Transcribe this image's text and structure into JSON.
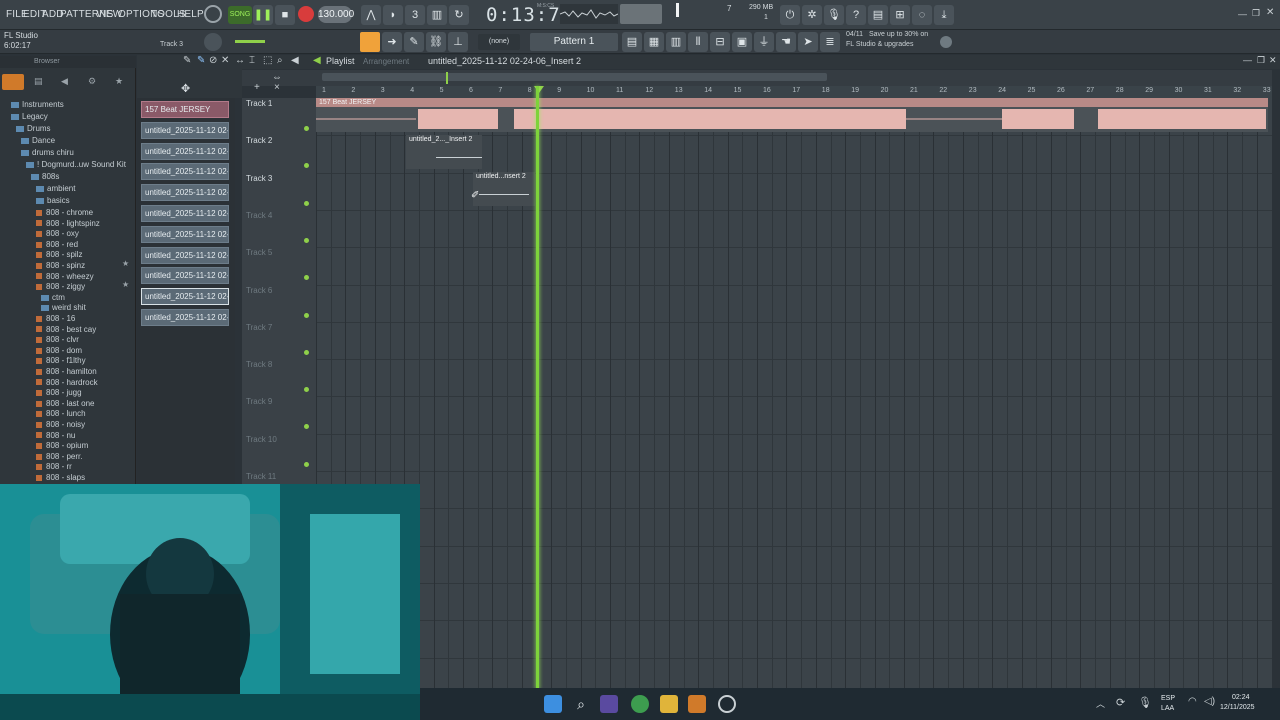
{
  "menu": [
    "FILE",
    "EDIT",
    "ADD",
    "PATTERNS",
    "VIEW",
    "OPTIONS",
    "TOOLS",
    "HELP"
  ],
  "transport": {
    "mode": "SONG",
    "tempo": "130.000",
    "time": "0:13:70",
    "time_label": "M:S:CS",
    "cpu_value": "7",
    "ram": "290 MB",
    "voices": "1"
  },
  "app": {
    "name": "FL Studio",
    "elapsed": "6:02:17",
    "hint_track": "Track 3"
  },
  "pattern": {
    "snap": "(none)",
    "name": "Pattern 1",
    "promo_date": "04/11",
    "promo_line1": "Save up to 30% on",
    "promo_line2": "FL Studio & upgrades"
  },
  "browser": {
    "title": "Browser",
    "items": [
      {
        "label": "Instruments",
        "type": "folder",
        "level": 1
      },
      {
        "label": "Legacy",
        "type": "folder",
        "level": 1
      },
      {
        "label": "Drums",
        "type": "folder",
        "level": 2
      },
      {
        "label": "Dance",
        "type": "folder",
        "level": 3
      },
      {
        "label": "drums chiru",
        "type": "folder",
        "level": 3
      },
      {
        "label": "! Dogmurd..uw Sound Kit",
        "type": "folder",
        "level": 4
      },
      {
        "label": "808s",
        "type": "folder",
        "level": 5
      },
      {
        "label": "ambient",
        "type": "folder",
        "level": 6
      },
      {
        "label": "basics",
        "type": "folder",
        "level": 6
      },
      {
        "label": "808 - chrome",
        "type": "file",
        "level": 6
      },
      {
        "label": "808 - lightspinz",
        "type": "file",
        "level": 6
      },
      {
        "label": "808 - oxy",
        "type": "file",
        "level": 6
      },
      {
        "label": "808 - red",
        "type": "file",
        "level": 6
      },
      {
        "label": "808 - spilz",
        "type": "file",
        "level": 6
      },
      {
        "label": "808 - spinz",
        "type": "file",
        "level": 6
      },
      {
        "label": "808 - wheezy",
        "type": "file",
        "level": 6
      },
      {
        "label": "808 - ziggy",
        "type": "file",
        "level": 6
      },
      {
        "label": "ctm",
        "type": "folder",
        "level": 7
      },
      {
        "label": "weird shit",
        "type": "folder",
        "level": 7
      },
      {
        "label": "808 - 16",
        "type": "file",
        "level": 6
      },
      {
        "label": "808 - best cay",
        "type": "file",
        "level": 6
      },
      {
        "label": "808 - clvr",
        "type": "file",
        "level": 6
      },
      {
        "label": "808 - dom",
        "type": "file",
        "level": 6
      },
      {
        "label": "808 - f1lthy",
        "type": "file",
        "level": 6
      },
      {
        "label": "808 - hamilton",
        "type": "file",
        "level": 6
      },
      {
        "label": "808 - hardrock",
        "type": "file",
        "level": 6
      },
      {
        "label": "808 - jugg",
        "type": "file",
        "level": 6
      },
      {
        "label": "808 - last one",
        "type": "file",
        "level": 6
      },
      {
        "label": "808 - lunch",
        "type": "file",
        "level": 6
      },
      {
        "label": "808 - noisy",
        "type": "file",
        "level": 6
      },
      {
        "label": "808 - nu",
        "type": "file",
        "level": 6
      },
      {
        "label": "808 - opium",
        "type": "file",
        "level": 6
      },
      {
        "label": "808 - perr.",
        "type": "file",
        "level": 6
      },
      {
        "label": "808 - rr",
        "type": "file",
        "level": 6
      },
      {
        "label": "808 - slaps",
        "type": "file",
        "level": 6
      }
    ]
  },
  "patterns": [
    "157 Beat JERSEY",
    "untitled_2025-11-12 02-...",
    "untitled_2025-11-12 02-...",
    "untitled_2025-11-12 02-...",
    "untitled_2025-11-12 02-...",
    "untitled_2025-11-12 02-...",
    "untitled_2025-11-12 02-...",
    "untitled_2025-11-12 02-...",
    "untitled_2025-11-12 02-...",
    "untitled_2025-11-12 02-...",
    "untitled_2025-11-12 02-..."
  ],
  "playlist": {
    "title": "Playlist",
    "section": "Arrangement",
    "path": "untitled_2025-11-12 02-24-06_Insert 2",
    "ruler": [
      "1",
      "2",
      "3",
      "4",
      "5",
      "6",
      "7",
      "8",
      "9",
      "10",
      "11",
      "12",
      "13",
      "14",
      "15",
      "16",
      "17",
      "18",
      "19",
      "20",
      "21",
      "22",
      "23",
      "24",
      "25",
      "26",
      "27",
      "28",
      "29",
      "30",
      "31",
      "32",
      "33"
    ],
    "tracks": [
      "Track 1",
      "Track 2",
      "Track 3",
      "Track 4",
      "Track 5",
      "Track 6",
      "Track 7",
      "Track 8",
      "Track 9",
      "Track 10",
      "Track 11"
    ],
    "clips": [
      {
        "label": "157 Beat JERSEY"
      },
      {
        "label": "untitled_2..._Insert 2"
      },
      {
        "label": "untitled...nsert 2"
      }
    ]
  },
  "taskbar": {
    "lang1": "ESP",
    "lang2": "LAA",
    "time": "02:24",
    "date": "12/11/2025"
  },
  "colors": {
    "accent_green": "#7ed33b",
    "clip_audio": "#e5b6b0",
    "record_red": "#d83c3c"
  }
}
